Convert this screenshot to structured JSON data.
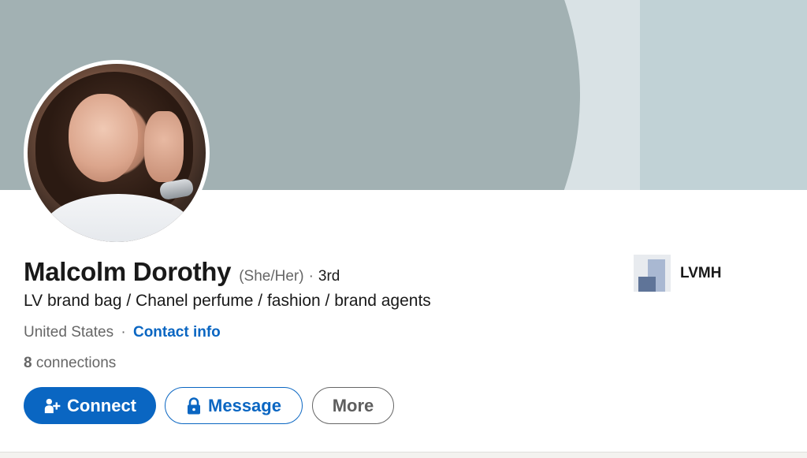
{
  "profile": {
    "name": "Malcolm Dorothy",
    "pronouns": "(She/Her)",
    "degree_separator": "·",
    "degree": "3rd",
    "headline": "LV brand bag / Chanel perfume / fashion / brand agents",
    "location": "United States",
    "location_separator": "·",
    "contact_info_label": "Contact info",
    "connections_count": "8",
    "connections_label": "connections"
  },
  "actions": {
    "connect_label": "Connect",
    "message_label": "Message",
    "more_label": "More"
  },
  "company": {
    "name": "LVMH"
  },
  "icons": {
    "connect": "add-person-icon",
    "message": "lock-icon"
  },
  "colors": {
    "accent": "#0a66c2",
    "banner_main": "#a2b1b3",
    "banner_light": "#d9e2e5",
    "banner_right": "#c1d2d6"
  }
}
